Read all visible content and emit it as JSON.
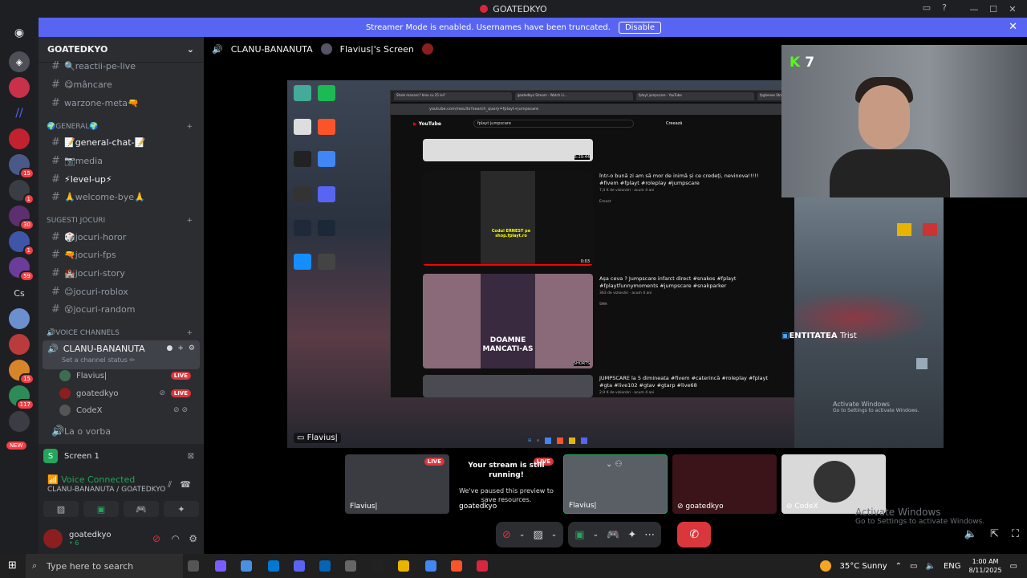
{
  "window": {
    "title": "GOATEDKYO"
  },
  "banner": {
    "text": "Streamer Mode is enabled. Usernames have been truncated.",
    "disable_label": "Disable"
  },
  "server": {
    "name": "GOATEDKYO"
  },
  "channels": [
    {
      "name": "🔍reactii-pe-live",
      "y": 0
    },
    {
      "name": "😋mâncare"
    },
    {
      "name": "warzone-meta🔫"
    }
  ],
  "categories": {
    "general": "🌍GENERAL🌍",
    "sugesti": "SUGESTI JOCURI",
    "voice": "🔊VOICE CHANNELS"
  },
  "general_channels": [
    "📝general-chat-📝",
    "📷media",
    "⚡level-up⚡",
    "🙏welcome-bye🙏"
  ],
  "game_channels": [
    "🎲jocuri-horor",
    "🔫jocuri-fps",
    "🏰jocuri-story",
    "😊jocuri-roblox",
    "😵jocuri-random"
  ],
  "voice_channel": {
    "name": "CLANU-BANANUTA",
    "status": "Set a channel status ✏"
  },
  "voice_users": [
    {
      "name": "Flavius|",
      "live": "LIVE"
    },
    {
      "name": "goatedkyo",
      "live": "LIVE"
    },
    {
      "name": "CodeX",
      "live": ""
    }
  ],
  "other_voice": "La o vorba",
  "screen_share": {
    "label": "Screen 1"
  },
  "voice_status": {
    "title": "Voice Connected",
    "sub": "CLANU-BANANUTA / GOATEDKYO"
  },
  "user": {
    "name": "goatedkyo",
    "status": "• 6"
  },
  "guild_badges": [
    "15",
    "1",
    "30",
    "1",
    "59",
    "15",
    "117"
  ],
  "guild_new": "NEW",
  "guild_cs": "Cs",
  "stage": {
    "channel": "CLANU-BANANUTA",
    "screen_title": "Flavius|'s Screen",
    "main_caption": "Flavius|",
    "cam_number": "7",
    "entity": "ENTITATEA",
    "entity_name": "Trist",
    "activate_title": "Activate Windows",
    "activate_sub": "Go to Settings to activate Windows."
  },
  "youtube": {
    "tabs": [
      "Shale mananc? bine cu 25 lei?",
      "goatedkyo Stream - Watch Li...",
      "fplayt jumpscare - YouTube",
      "fpgheneo Stream - Watch Li..."
    ],
    "url": "youtube.com/results?search_query=fplayt+jumpscare",
    "search": "fplayt jumpscare",
    "brand": "YouTube",
    "create": "Creează",
    "videos": [
      {
        "title": "într-o bună zi am să mor de inimă și ce credeți, nevinova!!!!! #fivem #fplayt #roleplay #jumpscare",
        "meta": "7,4 K de vizionări · acum 4 ani",
        "channel": "Ernest",
        "dur": "0:03"
      },
      {
        "title": "Așa ceva ? Jumpscare infarct direct #snakos #fplayt #fplaytfunnymoments #jumpscare #snakparker",
        "meta": "363 de vizionări · acum 4 ani",
        "channel": "SMA",
        "dur": "SHORTS"
      },
      {
        "title": "JUMPSCARE la 5 dimineata #fivem #caterincă #roleplay #fplayt #gta #live102 #gtav #gtarp #live68",
        "meta": "2,9 K de vizionări · acum 4 ani",
        "channel": "",
        "dur": ""
      }
    ],
    "first_dur": "5:29:44",
    "doamne": "DOAMNE",
    "mancati": "MANCATI-AS",
    "coupon": "Codul ERNEST pe shop.fplayt.ro"
  },
  "thumbs": [
    {
      "label": "Flavius|",
      "live": "LIVE"
    },
    {
      "label": "goatedkyo",
      "live": "LIVE",
      "paused_title": "Your stream is still running!",
      "paused_text": "We've paused this preview to save resources."
    },
    {
      "label": "Flavius|",
      "live": ""
    },
    {
      "label": "goatedkyo",
      "live": ""
    },
    {
      "label": "CodeX",
      "live": ""
    }
  ],
  "taskbar": {
    "search": "Type here to search",
    "weather": "35°C  Sunny",
    "lang": "ENG",
    "time": "1:00 AM",
    "date": "8/11/2025"
  },
  "colors": {
    "accent": "#5865f2",
    "live": "#da373c",
    "green": "#23a55a",
    "bg": "#1e1f22"
  }
}
